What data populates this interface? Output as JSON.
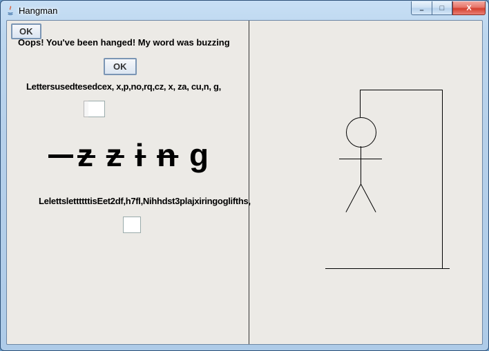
{
  "window": {
    "title": "Hangman",
    "buttons": {
      "min": "–",
      "max": "□",
      "close": "X"
    }
  },
  "stray_ok_label": "OK",
  "game": {
    "message": "Oops! You've been hanged! My word was buzzing",
    "ok_label": "OK",
    "letters_line_1": "Lettersusedtesedcex, x,p,no,rq,cz, x, za, cu,n, g,",
    "word_display_raw": "— z z i n g",
    "letters_line_2": "LelettslettttttisEet2df,h7fl,Nihhdst3plajxiringoglifths,",
    "answer": "buzzing",
    "revealed": [
      "",
      "",
      "z",
      "z",
      "i",
      "n",
      "g"
    ]
  },
  "hangman": {
    "parts_drawn": [
      "base",
      "post",
      "beam",
      "rope",
      "head",
      "body",
      "arms",
      "leg_l",
      "leg_r"
    ],
    "complete": true
  }
}
